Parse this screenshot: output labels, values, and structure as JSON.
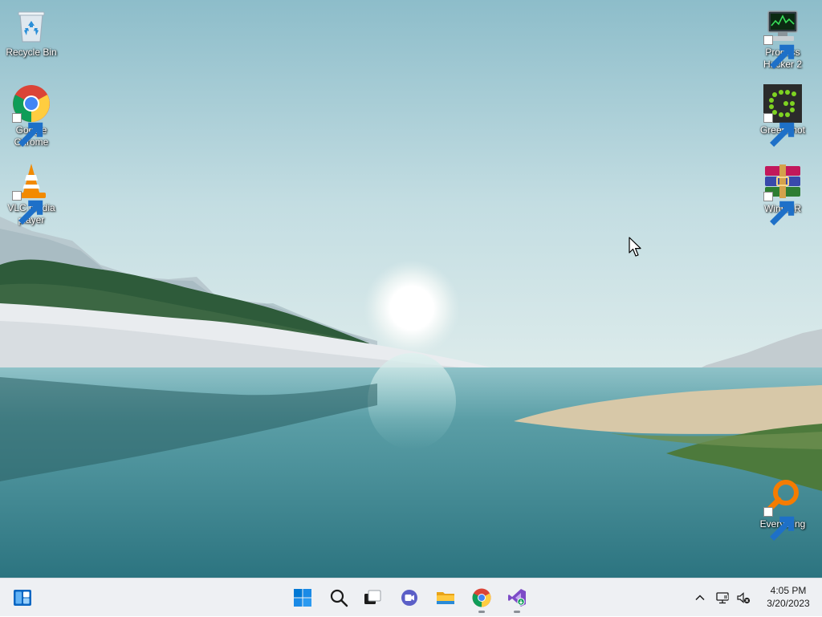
{
  "desktop": {
    "icons_left": [
      {
        "label": "Recycle Bin",
        "icon": "recycle-bin-icon"
      },
      {
        "label": "Google Chrome",
        "icon": "chrome-icon",
        "shortcut": true
      },
      {
        "label": "VLC media player",
        "icon": "vlc-icon",
        "shortcut": true
      }
    ],
    "icons_right": [
      {
        "label": "Process Hacker 2",
        "icon": "process-hacker-icon",
        "shortcut": true
      },
      {
        "label": "Greenshot",
        "icon": "greenshot-icon",
        "shortcut": true
      },
      {
        "label": "WinRAR",
        "icon": "winrar-icon",
        "shortcut": true
      },
      {
        "label": "Everything",
        "icon": "everything-icon",
        "shortcut": true
      }
    ]
  },
  "taskbar": {
    "widgets_icon": "widgets-icon",
    "pinned": [
      {
        "name": "start",
        "icon": "windows-start-icon"
      },
      {
        "name": "search",
        "icon": "search-icon"
      },
      {
        "name": "task-view",
        "icon": "task-view-icon"
      },
      {
        "name": "chat",
        "icon": "teams-chat-icon"
      },
      {
        "name": "file-explorer",
        "icon": "folder-icon"
      },
      {
        "name": "chrome",
        "icon": "chrome-icon",
        "running": true
      },
      {
        "name": "visual-studio",
        "icon": "visual-studio-icon",
        "running": true
      }
    ],
    "tray": {
      "overflow_icon": "chevron-up-icon",
      "network_icon": "network-icon",
      "volume_icon": "volume-muted-icon"
    },
    "clock": {
      "time": "4:05 PM",
      "date": "3/20/2023"
    }
  },
  "colors": {
    "taskbar_bg": "#eef0f3",
    "accent_blue": "#0067c0"
  }
}
